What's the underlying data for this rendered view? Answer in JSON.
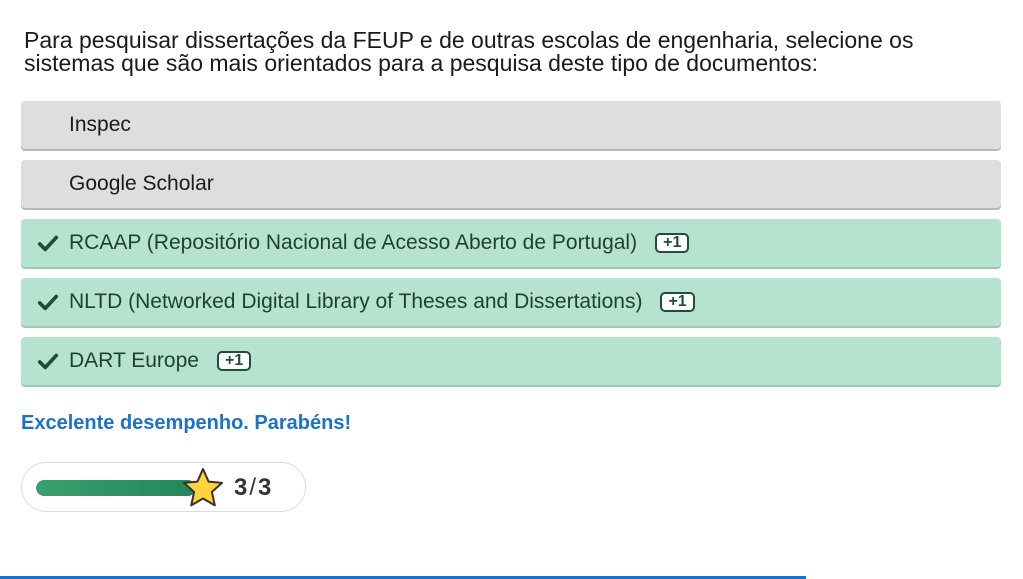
{
  "question": {
    "line1": "Para pesquisar dissertações da FEUP e de outras escolas de engenharia, selecione os",
    "line2": "sistemas que são mais orientados para a pesquisa deste tipo de documentos:"
  },
  "options": [
    {
      "label": "Inspec",
      "state": "neutral"
    },
    {
      "label": "Google Scholar",
      "state": "neutral"
    },
    {
      "label": "RCAAP (Repositório Nacional de Acesso Aberto de Portugal)",
      "state": "correct",
      "badge": "+1"
    },
    {
      "label": "NLTD (Networked Digital Library of Theses and Dissertations)",
      "state": "correct",
      "badge": "+1"
    },
    {
      "label": "DART Europe",
      "state": "correct",
      "badge": "+1"
    }
  ],
  "feedback": "Excelente desempenho. Parabéns!",
  "score": {
    "value": "3",
    "separator": "/",
    "max": "3",
    "progress_fraction": 1.0
  },
  "icons": {
    "check": "check-icon",
    "star": "star-icon"
  },
  "colors": {
    "correct_bg": "#b6e3cf",
    "neutral_bg": "#dedede",
    "feedback": "#1a73c9",
    "progress": "#2a9060"
  }
}
